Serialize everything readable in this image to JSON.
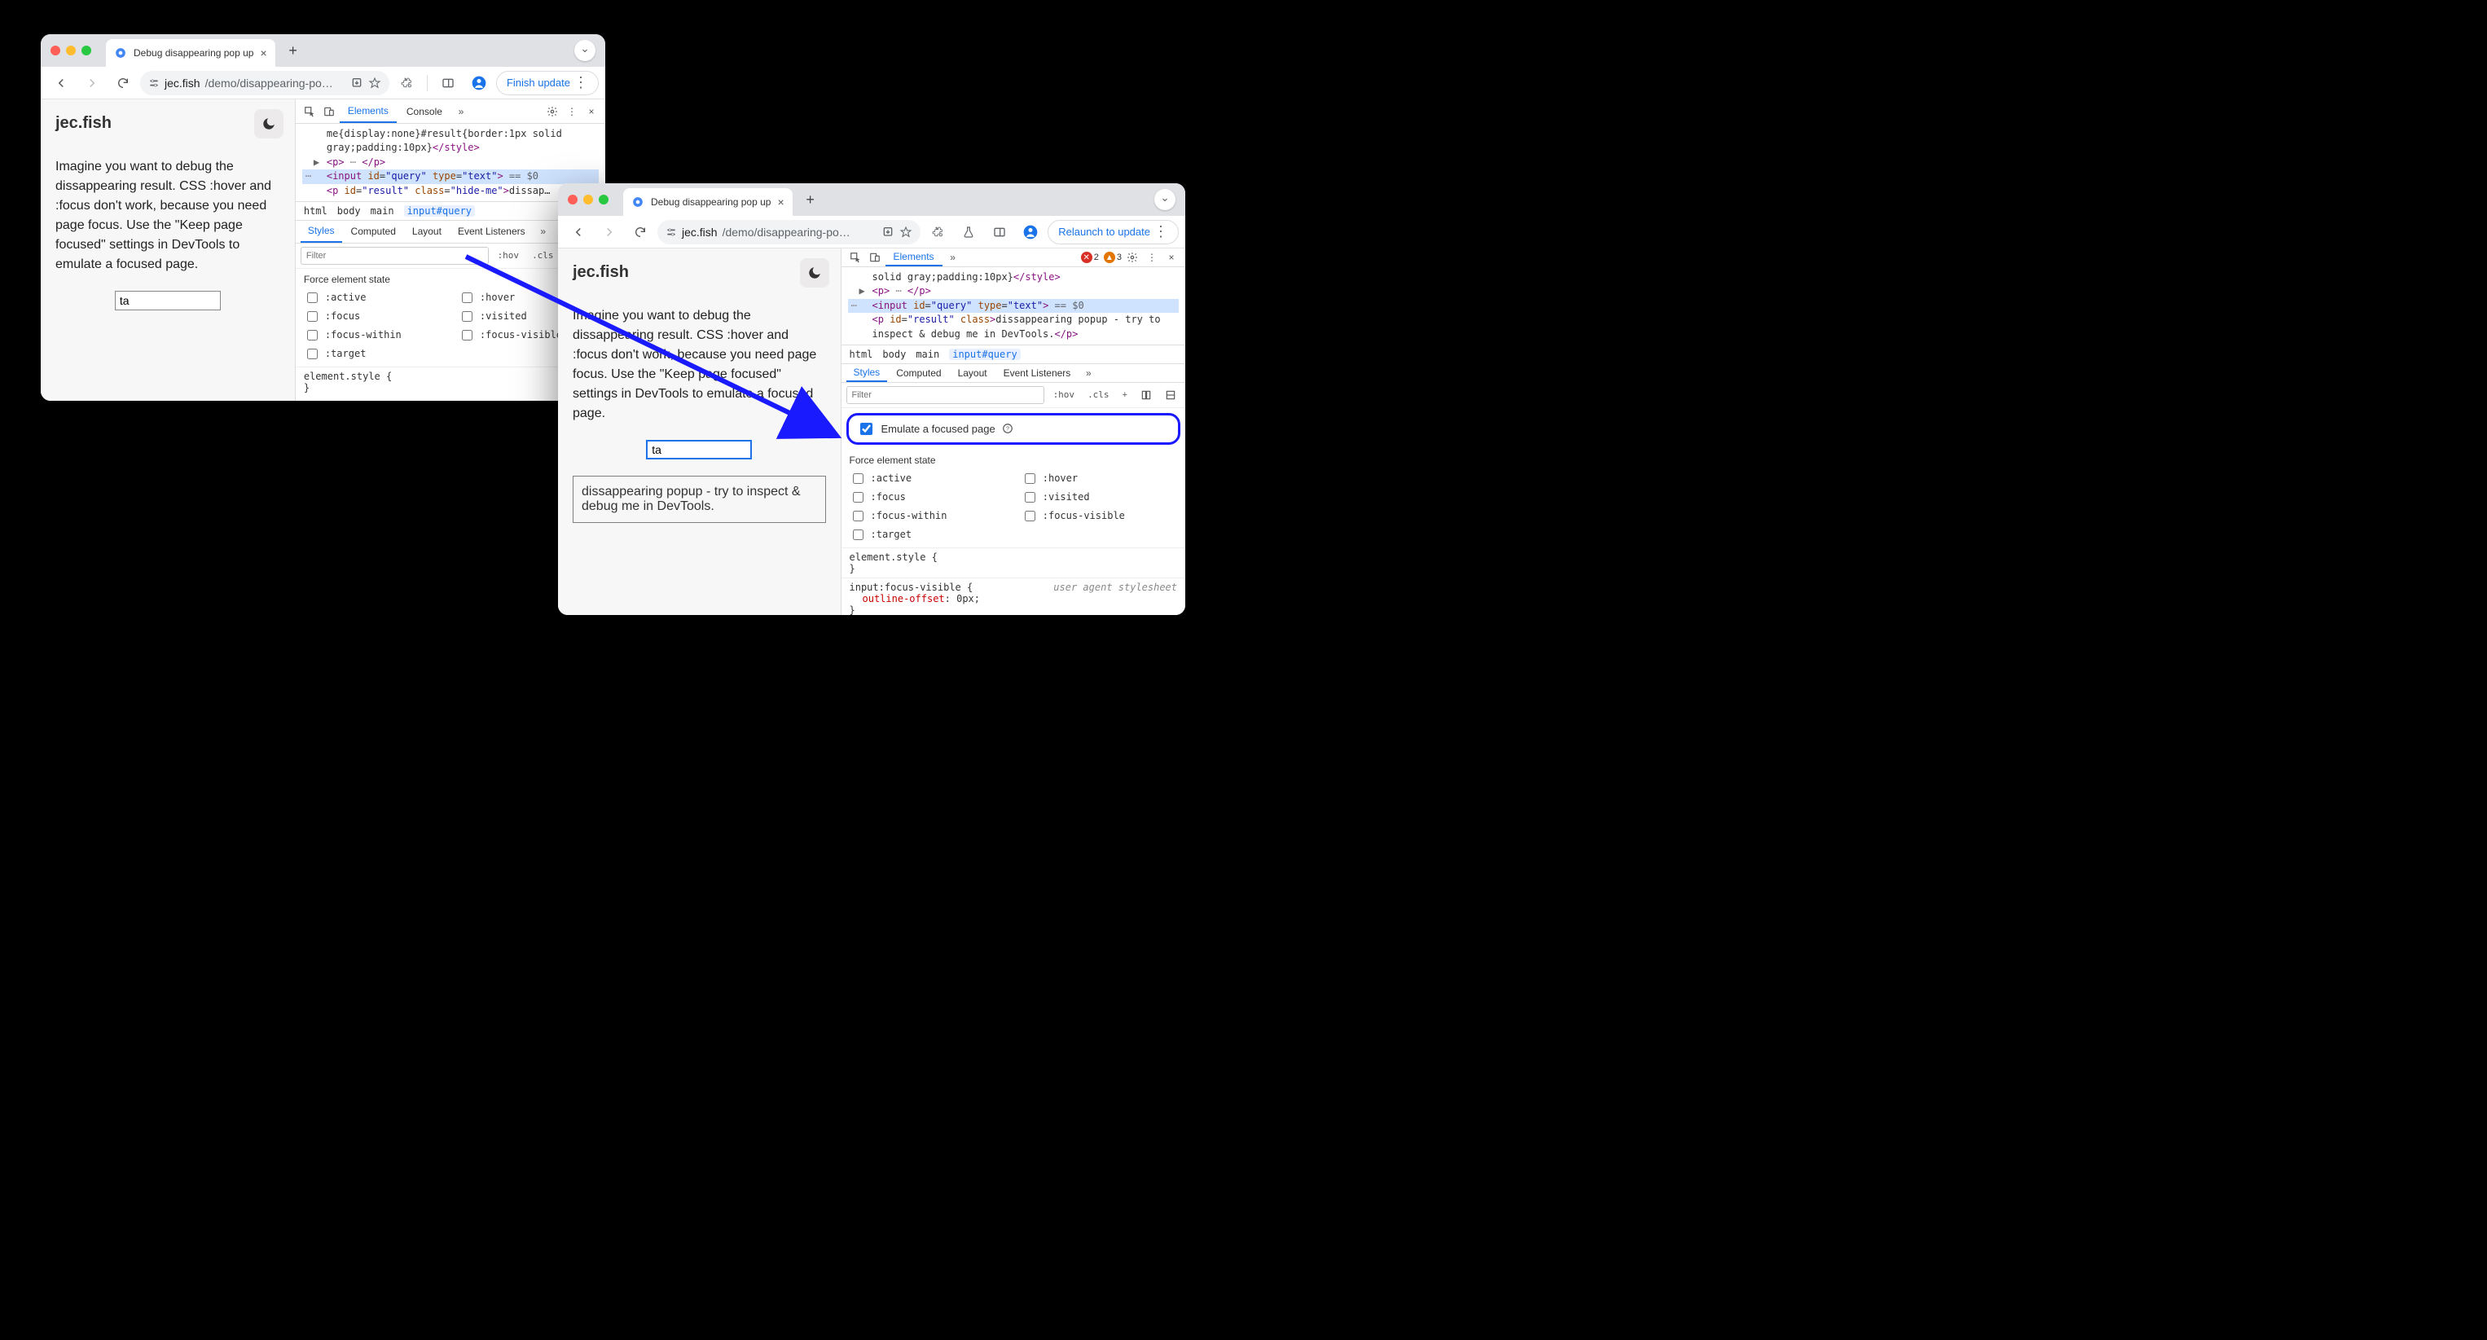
{
  "windowA": {
    "tabTitle": "Debug disappearing pop up",
    "url": {
      "host": "jec.fish",
      "path": "/demo/disappearing-po…"
    },
    "updateBtn": "Finish update",
    "page": {
      "siteTitle": "jec.fish",
      "paragraph": "Imagine you want to debug the dissappearing result. CSS :hover and :focus don't work, because you need page focus. Use the \"Keep page focused\" settings in DevTools to emulate a focused page.",
      "inputValue": "ta"
    },
    "devtools": {
      "tabs": {
        "elements": "Elements",
        "console": "Console"
      },
      "code_prefix": "me{display:none}#result{border:1px solid gray;padding:10px}",
      "highlighted_input": "<input id=\"query\" type=\"text\">",
      "result_line_prefix": "dissap",
      "breadcrumb": [
        "html",
        "body",
        "main",
        "input#query"
      ],
      "stylesTabs": {
        "styles": "Styles",
        "computed": "Computed",
        "layout": "Layout",
        "listeners": "Event Listeners"
      },
      "filterPlaceholder": "Filter",
      "forceTitle": "Force element state",
      "forceStates": [
        ":active",
        ":hover",
        ":focus",
        ":visited",
        ":focus-within",
        ":focus-visible",
        ":target"
      ],
      "elementStyle": "element.style {",
      "hov": ":hov",
      "cls": ".cls"
    }
  },
  "windowB": {
    "tabTitle": "Debug disappearing pop up",
    "url": {
      "host": "jec.fish",
      "path": "/demo/disappearing-po…"
    },
    "updateBtn": "Relaunch to update",
    "errCount": "2",
    "warnCount": "3",
    "page": {
      "siteTitle": "jec.fish",
      "paragraph": "Imagine you want to debug the dissappearing result. CSS :hover and :focus don't work, because you need page focus. Use the \"Keep page focused\" settings in DevTools to emulate a focused page.",
      "inputValue": "ta",
      "resultText": "dissappearing popup - try to inspect & debug me in DevTools."
    },
    "devtools": {
      "tabs": {
        "elements": "Elements"
      },
      "code_prefix": "solid gray;padding:10px}",
      "highlighted_input": "<input id=\"query\" type=\"text\">",
      "result_line": "dissappearing popup - try to inspect & debug me in DevTools.",
      "breadcrumb": [
        "html",
        "body",
        "main",
        "input#query"
      ],
      "stylesTabs": {
        "styles": "Styles",
        "computed": "Computed",
        "layout": "Layout",
        "listeners": "Event Listeners"
      },
      "filterPlaceholder": "Filter",
      "emulateLabel": "Emulate a focused page",
      "forceTitle": "Force element state",
      "forceStates": [
        ":active",
        ":hover",
        ":focus",
        ":visited",
        ":focus-within",
        ":focus-visible",
        ":target"
      ],
      "elementStyle": "element.style {",
      "uaBlock": {
        "selector": "input:focus-visible {",
        "prop": "outline-offset",
        "val": "0px",
        "src": "user agent stylesheet"
      },
      "hov": ":hov",
      "cls": ".cls"
    }
  },
  "eq0": " == $0"
}
